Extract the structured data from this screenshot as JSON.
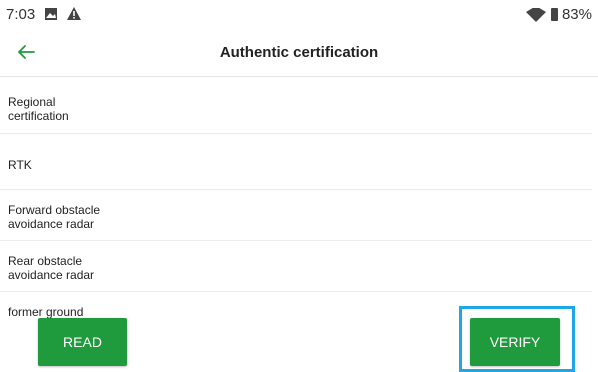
{
  "status_bar": {
    "time": "7:03",
    "battery": "83%"
  },
  "header": {
    "title": "Authentic certification"
  },
  "items": [
    {
      "label": "Regional\ncertification"
    },
    {
      "label": "RTK"
    },
    {
      "label": "Forward obstacle\navoidance radar"
    },
    {
      "label": "Rear obstacle\navoidance radar"
    },
    {
      "label": "former ground"
    }
  ],
  "buttons": {
    "read": "READ",
    "verify": "VERIFY"
  },
  "colors": {
    "accent_green": "#1f9a3c",
    "highlight_blue": "#1ea6e6"
  }
}
